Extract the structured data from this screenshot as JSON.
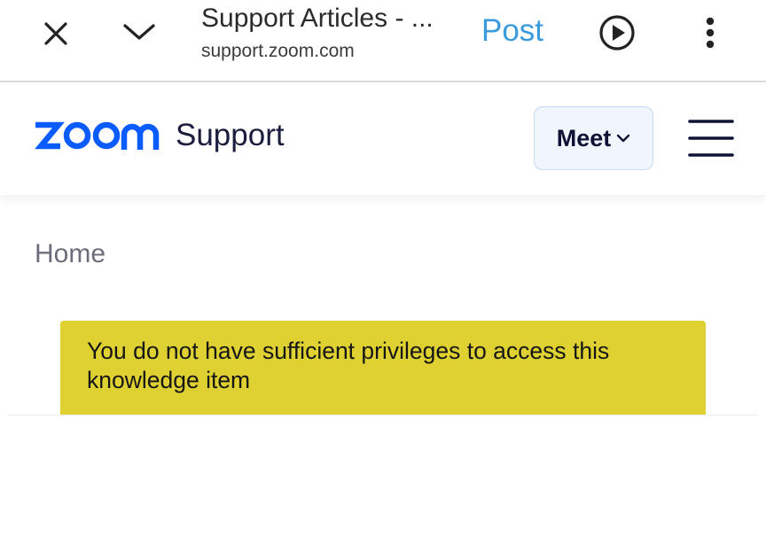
{
  "browser": {
    "title": "Support Articles - ...",
    "url": "support.zoom.com",
    "post_label": "Post",
    "icons": [
      "close-icon",
      "chevron-down-icon",
      "play-icon",
      "more-vertical-icon"
    ]
  },
  "header": {
    "logo_text": "zoom",
    "support_label": "Support",
    "product_menu_label": "Meet",
    "menu_icon": "hamburger-icon"
  },
  "breadcrumb": {
    "home": "Home"
  },
  "alert": {
    "message": "You do not have sufficient privileges to access this knowledge item"
  },
  "colors": {
    "brand_blue": "#0b5cff",
    "post_link": "#3a9bdc",
    "alert_bg": "#ded131",
    "meet_bg": "#f1f6fd"
  }
}
